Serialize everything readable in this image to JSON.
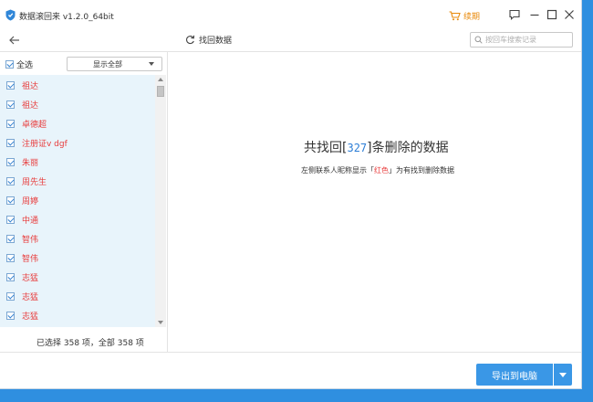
{
  "window": {
    "title": "数据滚回来 v1.2.0_64bit",
    "renew_label": "续期"
  },
  "toolbar": {
    "recover_label": "找回数据",
    "search_placeholder": "按回车搜索记录"
  },
  "left_panel": {
    "select_all_label": "全选",
    "filter_selected": "显示全部",
    "contacts": [
      {
        "name": "祖达",
        "checked": true
      },
      {
        "name": "祖达",
        "checked": true
      },
      {
        "name": "卓德超",
        "checked": true
      },
      {
        "name": "注册证v dgf",
        "checked": true
      },
      {
        "name": "朱丽",
        "checked": true
      },
      {
        "name": "周先生",
        "checked": true
      },
      {
        "name": "周婷",
        "checked": true
      },
      {
        "name": "中通",
        "checked": true
      },
      {
        "name": "智伟",
        "checked": true
      },
      {
        "name": "智伟",
        "checked": true
      },
      {
        "name": "志猛",
        "checked": true
      },
      {
        "name": "志猛",
        "checked": true
      },
      {
        "name": "志猛",
        "checked": true
      }
    ],
    "summary": "已选择 358 项，全部 358 项"
  },
  "main": {
    "headline_prefix": "共找回[",
    "deleted_count": "327",
    "headline_suffix": "]条删除的数据",
    "hint_prefix": "左侧联系人昵称显示「",
    "hint_red": "红色",
    "hint_suffix": "」为有找到删除数据"
  },
  "footer": {
    "export_label": "导出到电脑"
  },
  "colors": {
    "accent": "#3a97e6",
    "deleted_red": "#e83c3c",
    "list_bg": "#e8f4fb",
    "renew_orange": "#e8890a",
    "desktop_blue": "#2f8fe0"
  }
}
